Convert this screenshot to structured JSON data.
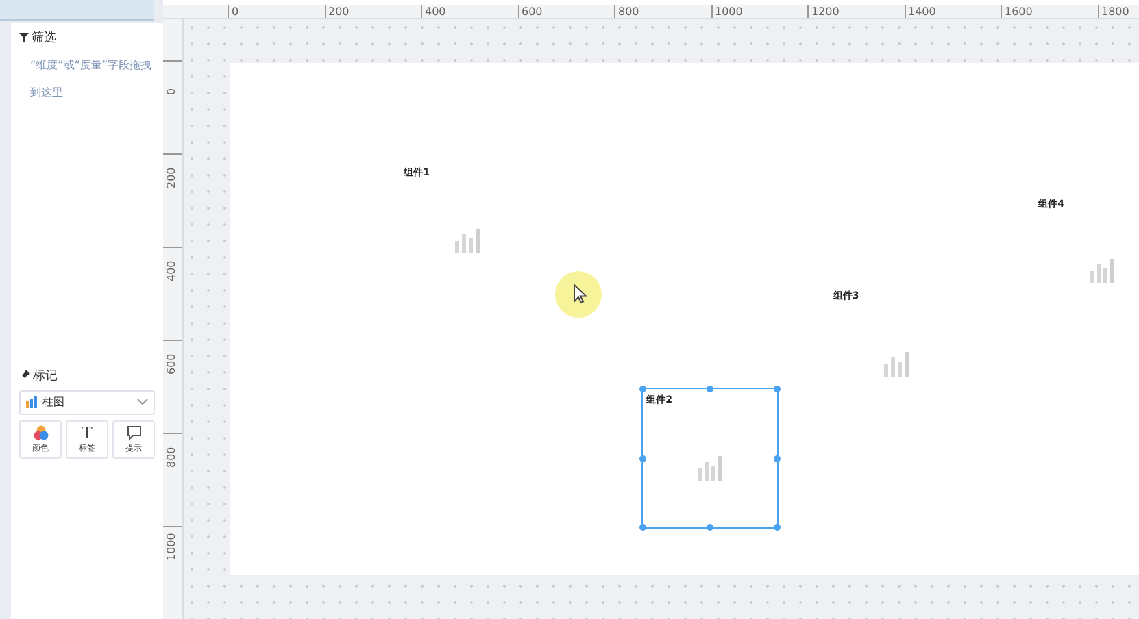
{
  "filter": {
    "title": "筛选",
    "hint": "“维度”或“度量”字段拖拽到这里"
  },
  "marks": {
    "title": "标记",
    "chart_type": "柱图",
    "buttons": [
      {
        "kind": "color",
        "label": "颜色"
      },
      {
        "kind": "text",
        "label": "标签",
        "glyph": "T"
      },
      {
        "kind": "tooltip",
        "label": "提示"
      }
    ]
  },
  "ruler": {
    "horizontal": [
      "0",
      "200",
      "400",
      "600",
      "800",
      "1000",
      "1200",
      "1400",
      "1600",
      "1800"
    ],
    "vertical": [
      "0",
      "200",
      "400",
      "600",
      "800",
      "1000"
    ]
  },
  "components": [
    {
      "title": "组件1",
      "selected": false
    },
    {
      "title": "组件4",
      "selected": false
    },
    {
      "title": "组件3",
      "selected": false
    },
    {
      "title": "组件2",
      "selected": true
    }
  ]
}
